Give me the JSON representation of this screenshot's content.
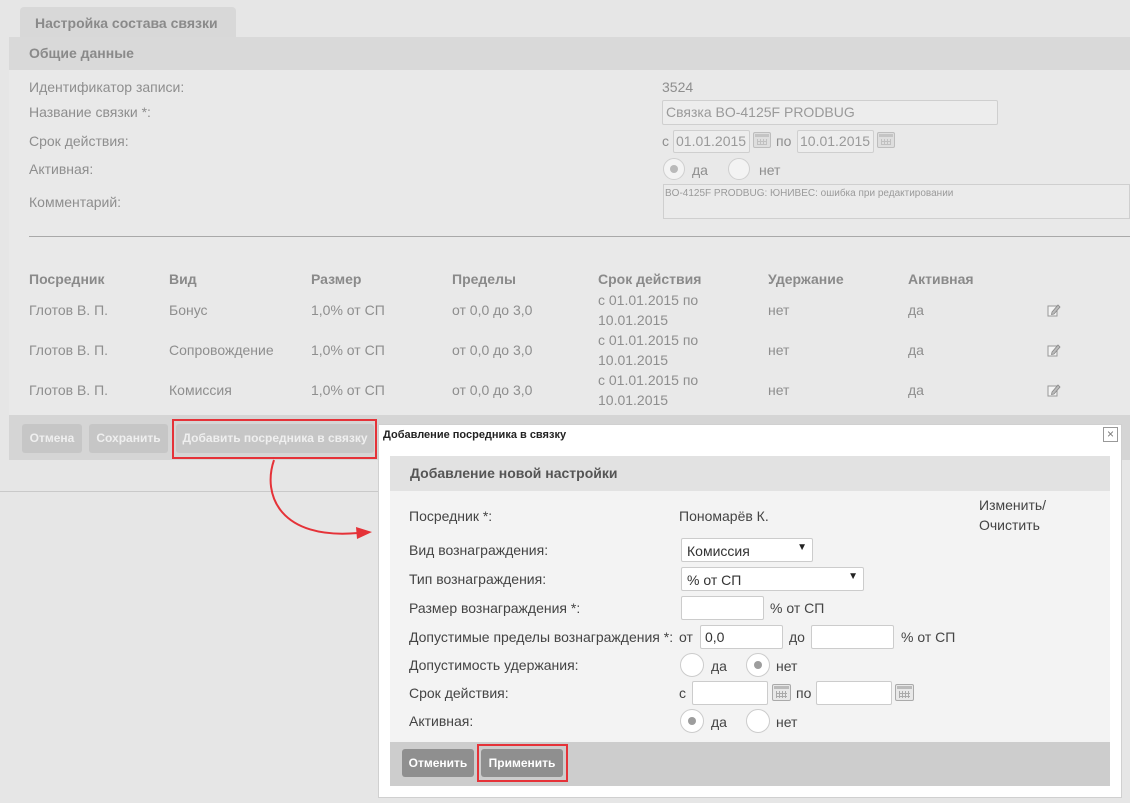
{
  "page": {
    "tab_title": "Настройка состава связки",
    "section_title": "Общие данные"
  },
  "general": {
    "id_label": "Идентификатор записи:",
    "id_value": "3524",
    "name_label": "Название связки *:",
    "name_value": "Связка BO-4125F PRODBUG",
    "period_label": "Срок действия:",
    "period_from_prefix": "с",
    "period_from": "01.01.2015",
    "period_to_prefix": "по",
    "period_to": "10.01.2015",
    "active_label": "Активная:",
    "active_yes": "да",
    "active_no": "нет",
    "comment_label": "Комментарий:",
    "comment_value": "BO-4125F PRODBUG: ЮНИВЕС: ошибка при редактировании"
  },
  "table": {
    "headers": [
      "Посредник",
      "Вид",
      "Размер",
      "Пределы",
      "Срок действия",
      "Удержание",
      "Активная"
    ],
    "rows": [
      {
        "agent": "Глотов В. П.",
        "kind": "Бонус",
        "size": "1,0% от СП",
        "limits": "от 0,0 до 3,0",
        "period1": "с 01.01.2015 по",
        "period2": "10.01.2015",
        "hold": "нет",
        "active": "да"
      },
      {
        "agent": "Глотов В. П.",
        "kind": "Сопровождение",
        "size": "1,0% от СП",
        "limits": "от 0,0 до 3,0",
        "period1": "с 01.01.2015 по",
        "period2": "10.01.2015",
        "hold": "нет",
        "active": "да"
      },
      {
        "agent": "Глотов В. П.",
        "kind": "Комиссия",
        "size": "1,0% от СП",
        "limits": "от 0,0 до 3,0",
        "period1": "с 01.01.2015 по",
        "period2": "10.01.2015",
        "hold": "нет",
        "active": "да"
      }
    ]
  },
  "buttons": {
    "cancel": "Отмена",
    "save": "Сохранить",
    "add_agent": "Добавить посредника в связку"
  },
  "modal": {
    "window_title": "Добавление посредника в связку",
    "close_symbol": "×",
    "header": "Добавление новой настройки",
    "agent_label": "Посредник *:",
    "agent_value": "Пономарёв К.",
    "agent_change": "Изменить/",
    "agent_clear": "Очистить",
    "reward_kind_label": "Вид вознаграждения:",
    "reward_kind_value": "Комиссия",
    "reward_type_label": "Тип вознаграждения:",
    "reward_type_value": "% от СП",
    "reward_size_label": "Размер вознаграждения *:",
    "reward_size_value": "",
    "reward_size_unit": "% от СП",
    "limits_label": "Допустимые пределы вознаграждения *:",
    "limits_from_prefix": "от",
    "limits_from_value": "0,0",
    "limits_to_prefix": "до",
    "limits_to_value": "",
    "limits_unit": "% от СП",
    "hold_label": "Допустимость удержания:",
    "hold_yes": "да",
    "hold_no": "нет",
    "period_label": "Срок действия:",
    "period_from_prefix": "с",
    "period_from": "",
    "period_to_prefix": "по",
    "period_to": "",
    "active_label": "Активная:",
    "active_yes": "да",
    "active_no": "нет",
    "cancel_button": "Отменить",
    "apply_button": "Применить"
  },
  "colors": {
    "highlight": "#e53238",
    "arrow": "#e53238"
  }
}
